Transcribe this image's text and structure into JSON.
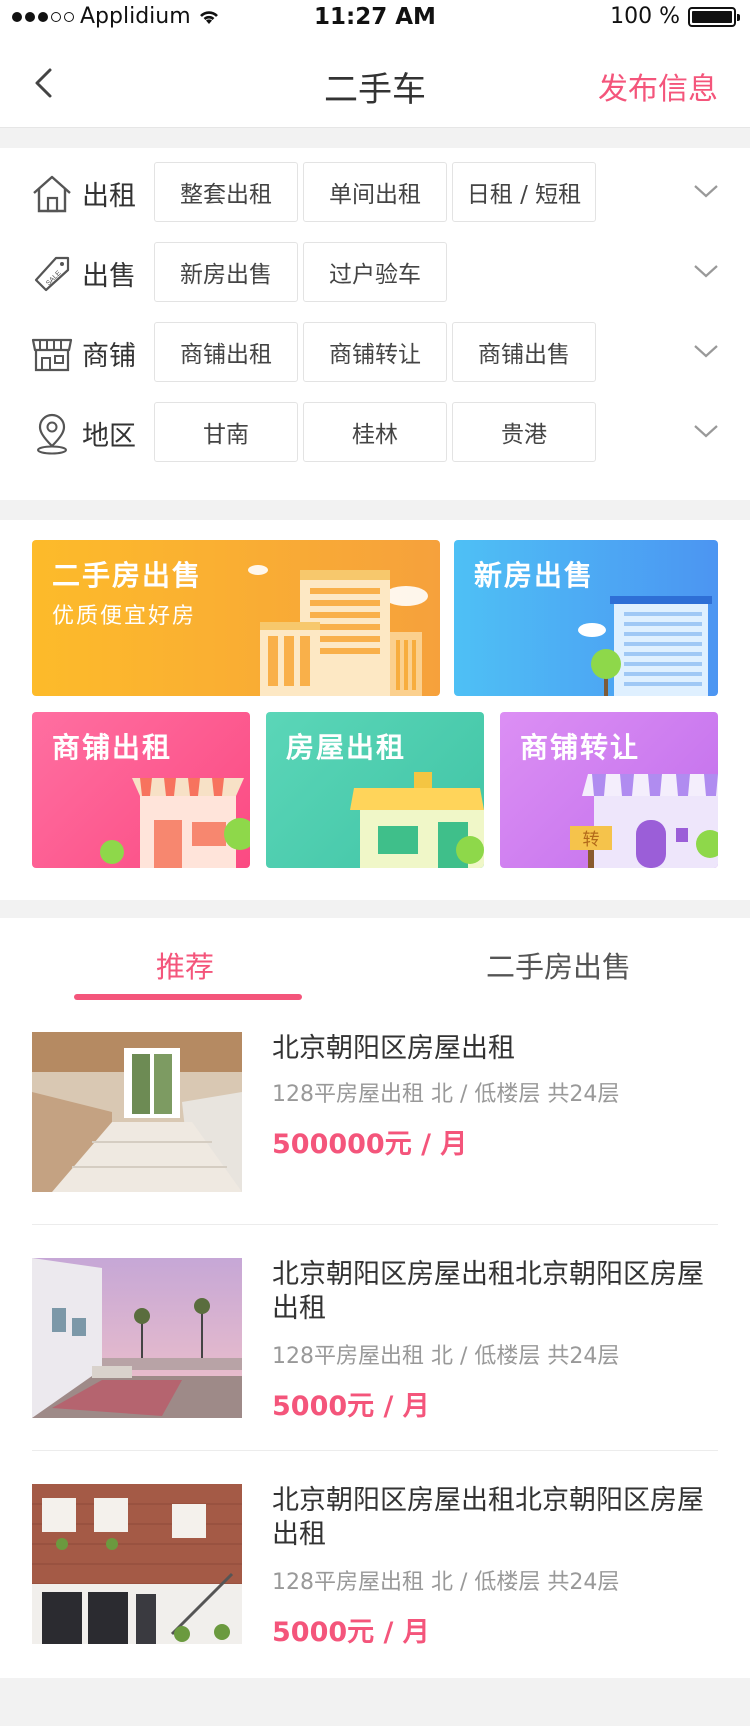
{
  "status_bar": {
    "carrier": "Applidium",
    "time": "11:27 AM",
    "battery": "100 %"
  },
  "nav": {
    "title": "二手车",
    "action": "发布信息"
  },
  "filters": [
    {
      "label": "出租",
      "icon": "house-icon",
      "options": [
        "整套出租",
        "单间出租",
        "日租 / 短租"
      ]
    },
    {
      "label": "出售",
      "icon": "sale-tag-icon",
      "options": [
        "新房出售",
        "过户验车"
      ]
    },
    {
      "label": "商铺",
      "icon": "shop-icon",
      "options": [
        "商铺出租",
        "商铺转让",
        "商铺出售"
      ]
    },
    {
      "label": "地区",
      "icon": "location-pin-icon",
      "options": [
        "甘南",
        "桂林",
        "贵港"
      ]
    }
  ],
  "cards": {
    "secondhand": {
      "title": "二手房出售",
      "subtitle": "优质便宜好房",
      "color": "#fbb62a"
    },
    "newhouse": {
      "title": "新房出售",
      "color": "#4aa3f3"
    },
    "shop_rent": {
      "title": "商铺出租",
      "color": "#fb5a8e"
    },
    "house_rent": {
      "title": "房屋出租",
      "color": "#4fcfb1"
    },
    "shop_transfer": {
      "title": "商铺转让",
      "color": "#cf7ef0",
      "sign": "转"
    }
  },
  "tabs": {
    "active": "推荐",
    "inactive": "二手房出售"
  },
  "listings": [
    {
      "title": "北京朝阳区房屋出租",
      "desc": "128平房屋出租  北 / 低楼层  共24层",
      "price": "500000元 / 月"
    },
    {
      "title": "北京朝阳区房屋出租北京朝阳区房屋出租",
      "desc": "128平房屋出租  北 / 低楼层  共24层",
      "price": "5000元 / 月"
    },
    {
      "title": "北京朝阳区房屋出租北京朝阳区房屋出租",
      "desc": "128平房屋出租  北 / 低楼层  共24层",
      "price": "5000元 / 月"
    }
  ],
  "colors": {
    "accent": "#f4557b"
  }
}
